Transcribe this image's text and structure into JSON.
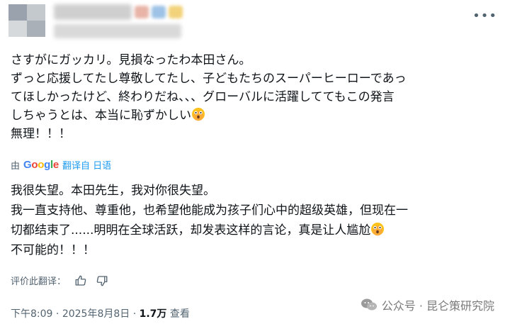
{
  "tweet": {
    "original_lines": [
      "さすがにガッカリ。見損なったわ本田さん。",
      "ずっと応援してたし尊敬してたし、子どもたちのスーパーヒーローであっ",
      "てほしかったけど、終わりだね、、、グローバルに活躍しててもこの発言",
      "しちゃうとは、本当に恥ずかしい",
      "無理！！！"
    ],
    "translated_by_prefix": "由",
    "translation_brand": "Google",
    "translation_link": "翻译自 日语",
    "translated_lines": [
      "我很失望。本田先生，我对你很失望。",
      "我一直支持他、尊重他，也希望他能成为孩子们心中的超级英雄，但现在一",
      "切都结束了......明明在全球活跃，却发表这样的言论，真是让人尴尬",
      "不可能的！！！"
    ],
    "rate_label": "评价此翻译："
  },
  "meta": {
    "time": "下午8:09",
    "sep1": " · ",
    "date": "2025年8月8日",
    "sep2": " · ",
    "views": "1.7万",
    "views_label": " 查看"
  },
  "watermark": {
    "text": "公众号 · 昆仑策研究院"
  },
  "icons": {
    "more": "more-icon",
    "emoji": "flushed-face-emoji",
    "thumbs_up": "thumbs-up-icon",
    "thumbs_down": "thumbs-down-icon",
    "wechat": "wechat-icon"
  },
  "colors": {
    "link": "#1d9bf0",
    "secondary_text": "#536471",
    "primary_text": "#0f1419"
  }
}
